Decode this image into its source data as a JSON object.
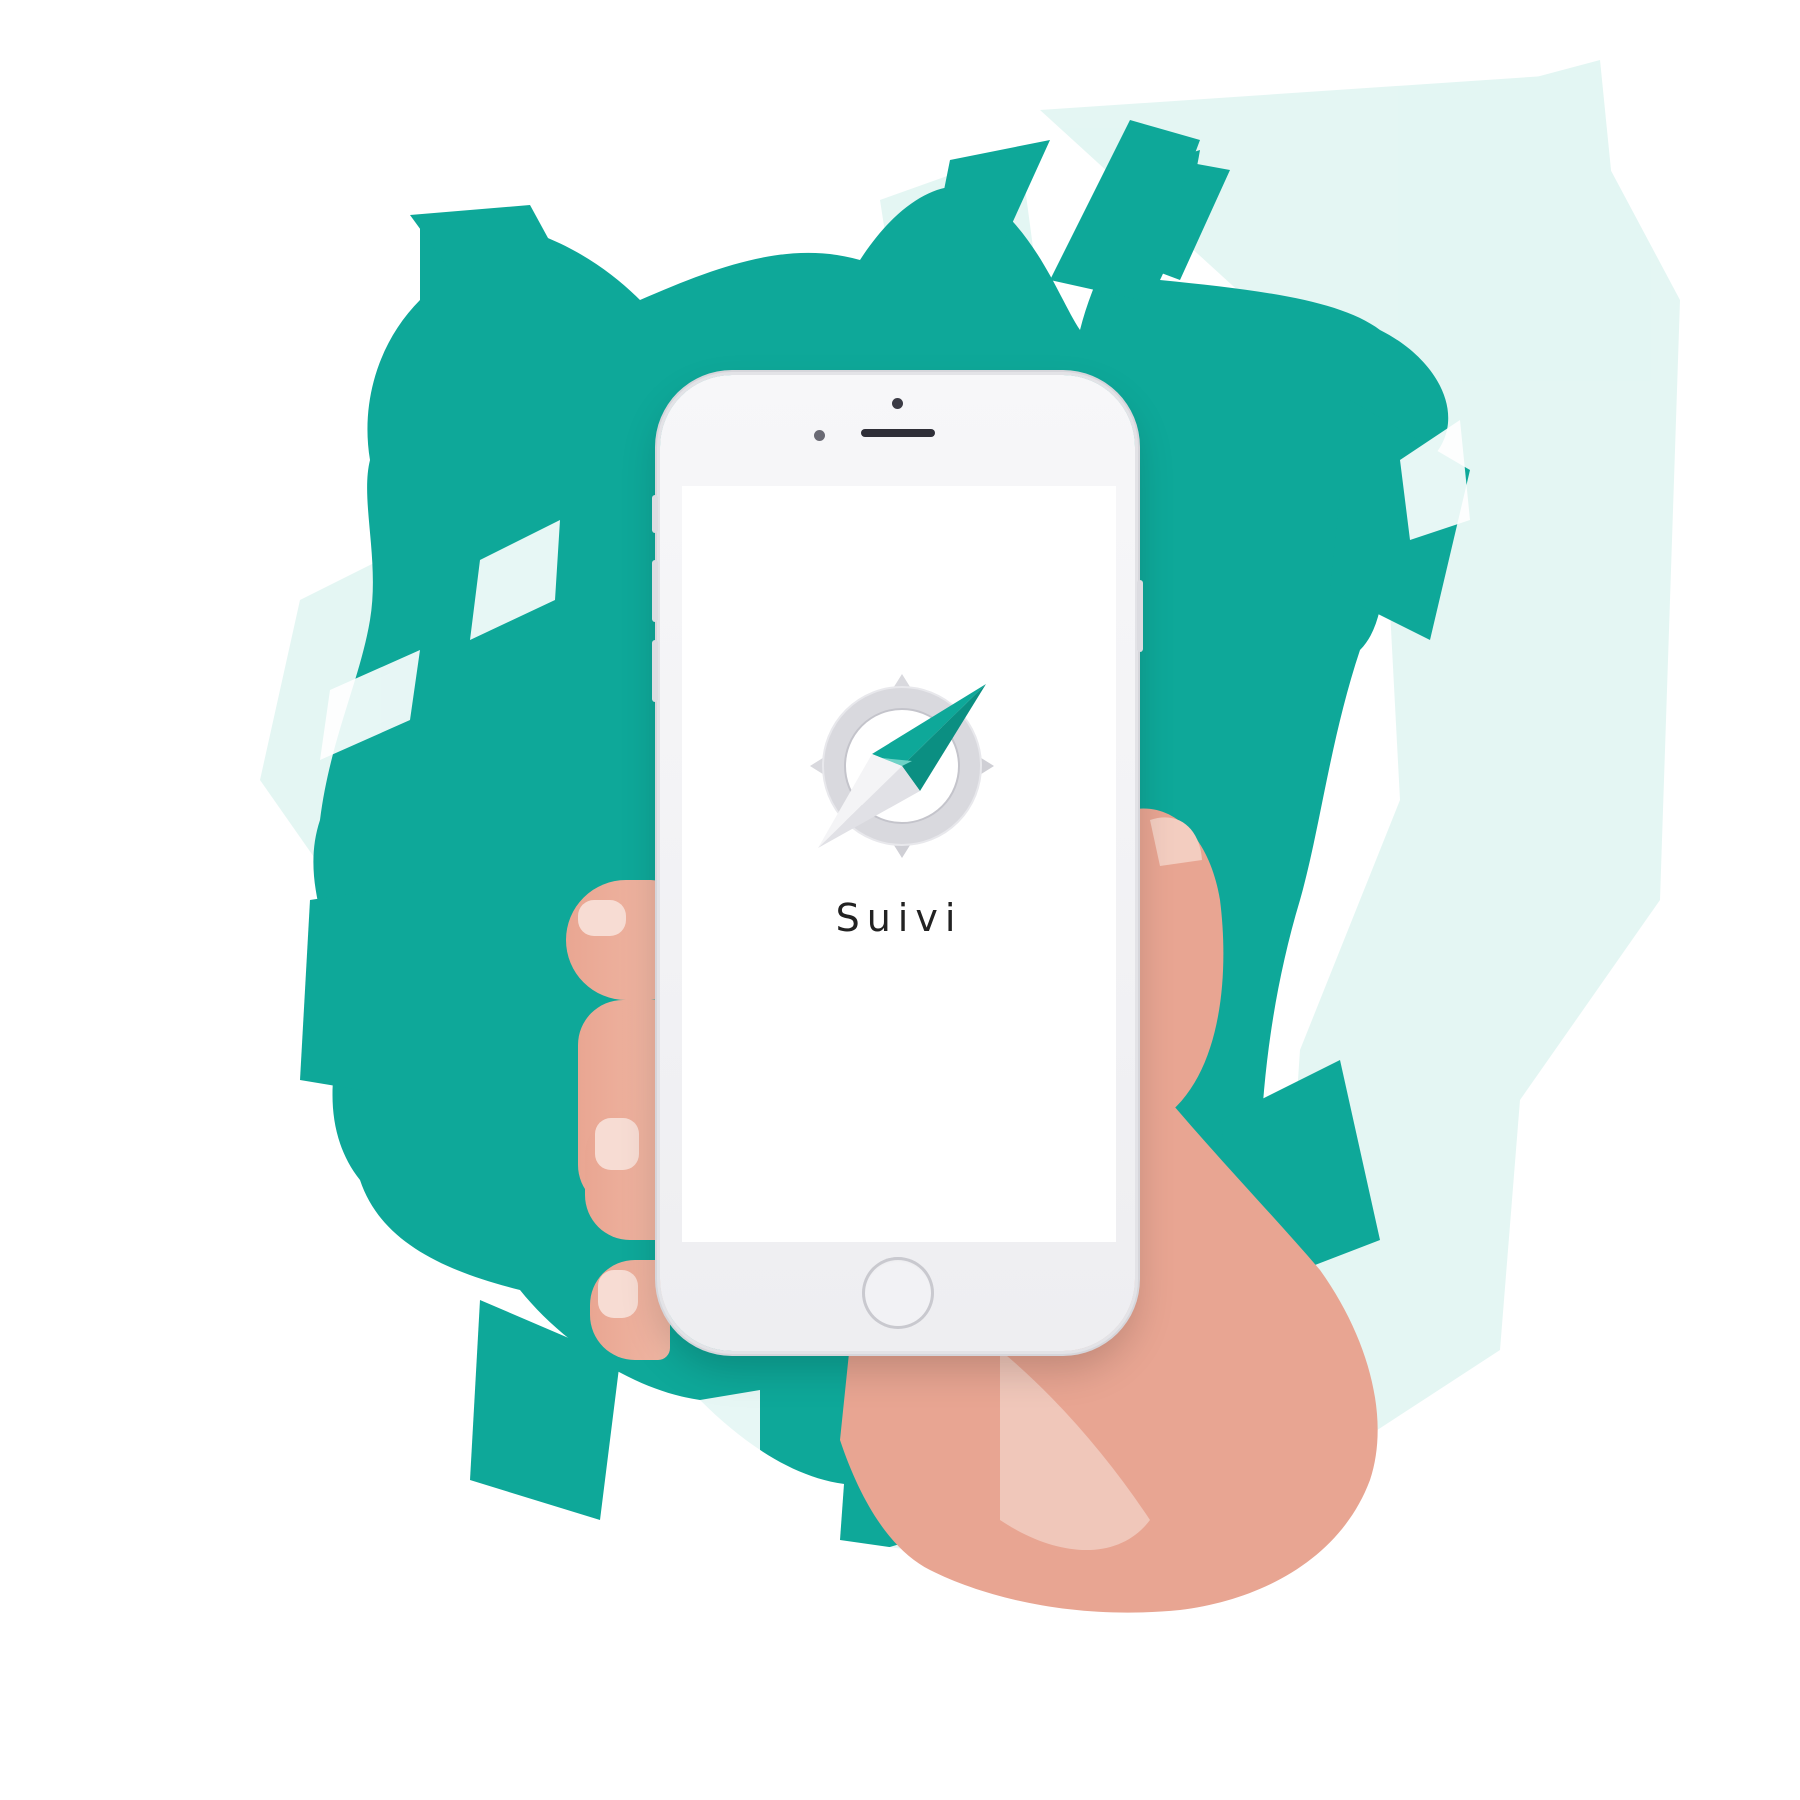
{
  "app": {
    "name": "Suivi",
    "logo_icon": "compass-icon"
  },
  "colors": {
    "brand": "#0EA899",
    "brand_light": "#6FD3C7",
    "paint_wash": "#D7F3EF",
    "logo_ring": "#D9D9DE",
    "skin": "#E8A592"
  },
  "device": {
    "type": "smartphone",
    "color": "white"
  }
}
